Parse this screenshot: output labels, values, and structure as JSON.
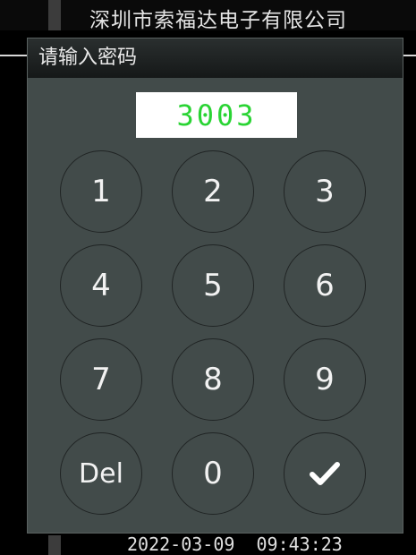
{
  "background": {
    "title": "深圳市索福达电子有限公司",
    "datetime": "2022-03-09  09:43:23"
  },
  "dialog": {
    "title": "请输入密码",
    "password_value": "3003"
  },
  "keypad": {
    "k1": "1",
    "k2": "2",
    "k3": "3",
    "k4": "4",
    "k5": "5",
    "k6": "6",
    "k7": "7",
    "k8": "8",
    "k9": "9",
    "del": "Del",
    "k0": "0",
    "confirm_icon": "check-icon"
  },
  "colors": {
    "display_text": "#2ad434",
    "dialog_bg": "#424b4a"
  }
}
